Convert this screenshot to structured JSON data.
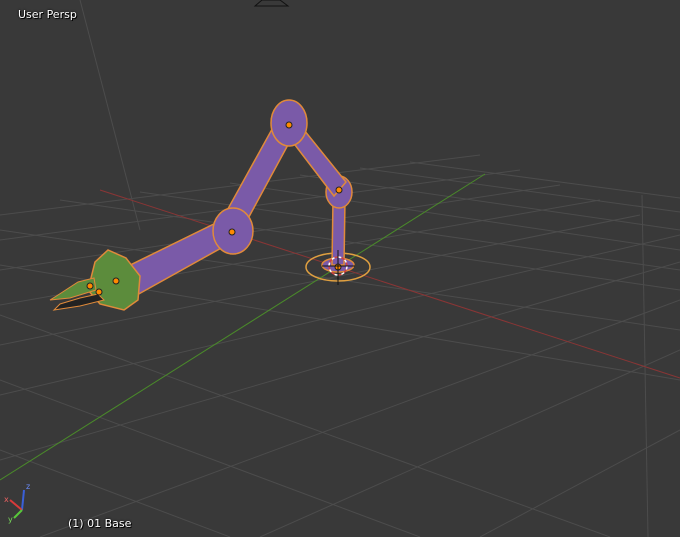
{
  "viewport": {
    "view_label": "User Persp",
    "object_label": "(1) 01 Base",
    "axis_gizmo": {
      "z_label": "z",
      "y_label": "y",
      "x_label": "x"
    }
  },
  "colors": {
    "background": "#393939",
    "grid": "#4a4a4a",
    "x_axis": "#8a3a3a",
    "y_axis": "#4a8a2a",
    "arm": "#7a5aa8",
    "arm_outline": "#e08a3a",
    "gripper": "#5c8c3c",
    "pivot": "#ff8a00"
  }
}
